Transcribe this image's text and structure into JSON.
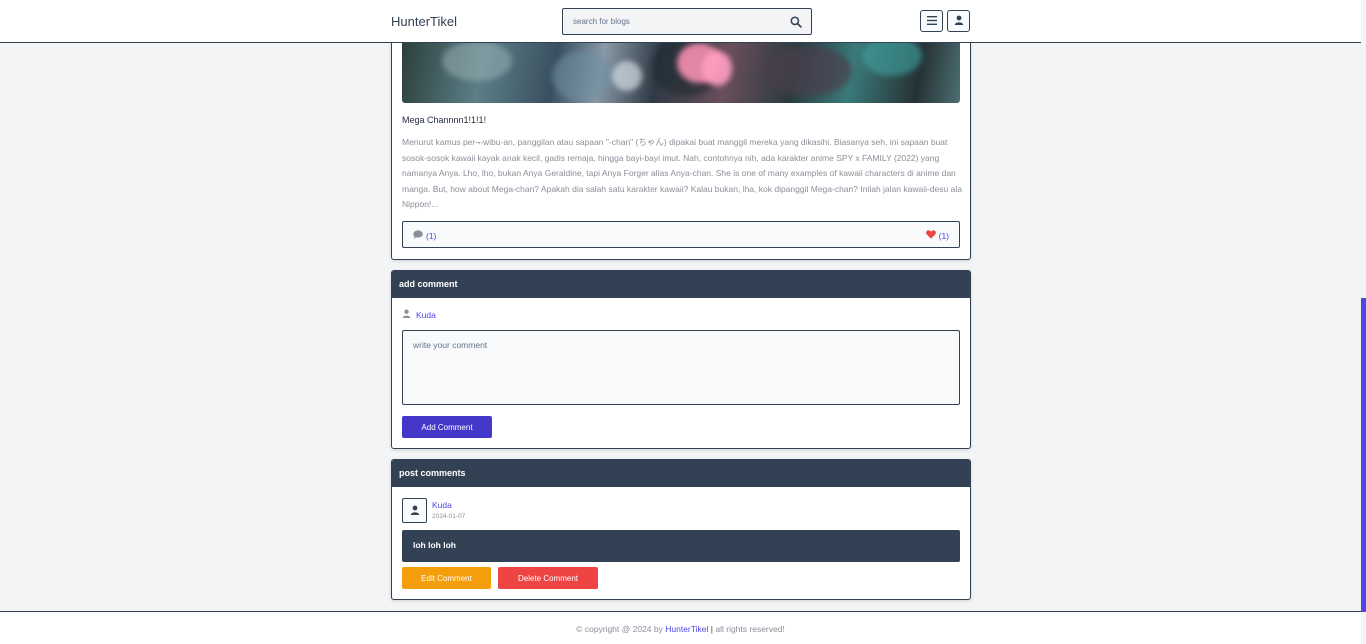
{
  "header": {
    "brand": "HunterTikel",
    "search_placeholder": "search for blogs"
  },
  "post": {
    "title": "Mega Channnn1!1!1!",
    "body": "Menurut kamus per¬-wibu-an, panggilan atau sapaan \"-chan\" (ちゃん) dipakai buat manggil mereka yang dikasihi. Biasanya seh, ini sapaan buat sosok-sosok kawaii kayak anak kecil, gadis remaja, hingga bayi-bayi imut. Nah, contohnya nih, ada karakter anime SPY x FAMILY (2022) yang namanya Anya. Lho, lho, bukan Anya Geraldine, tapi Anya Forger alias Anya-chan. She is one of many examples of kawaii characters di anime dan manga. But, how about Mega-chan? Apakah dia salah satu karakter kawaii? Kalau bukan, lha, kok dipanggil Mega-chan? Inilah jalan kawaii-desu ala Nippon!...",
    "comment_count": "(1)",
    "like_count": "(1)"
  },
  "add_comment": {
    "heading": "add comment",
    "author": "Kuda",
    "textarea_placeholder": "write your comment",
    "submit_label": "Add Comment"
  },
  "post_comments": {
    "heading": "post comments",
    "items": [
      {
        "author": "Kuda",
        "date": "2024-01-07",
        "text": "loh loh loh",
        "edit_label": "Edit Comment",
        "delete_label": "Delete Comment"
      }
    ]
  },
  "footer": {
    "prefix": "© copyright @ 2024 by",
    "brand": "HunterTikel",
    "separator": "|",
    "suffix": "all rights reserved!"
  },
  "colors": {
    "primary": "#334155",
    "accent": "#4f46e5",
    "warning": "#f59e0b",
    "danger": "#ef4444",
    "heart": "#ef4444"
  },
  "icons": {
    "search": "search-icon",
    "menu": "menu-icon",
    "user": "user-icon",
    "comment": "comment-icon",
    "heart": "heart-icon"
  }
}
